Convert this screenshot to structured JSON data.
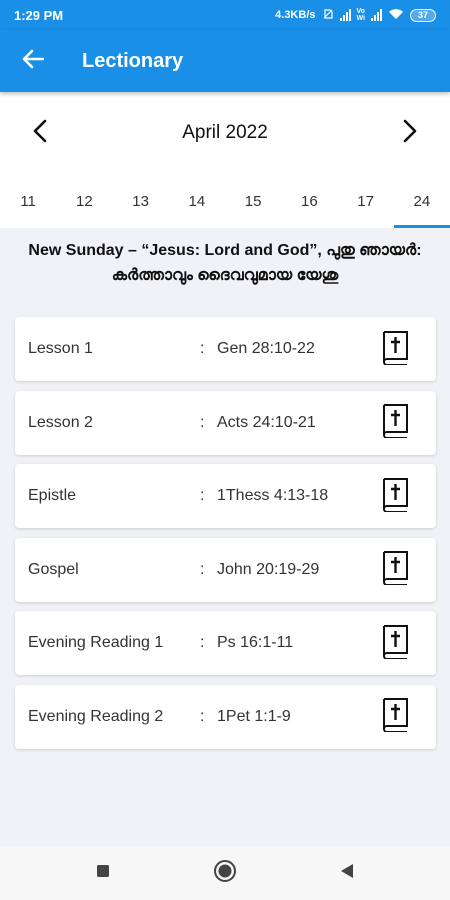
{
  "status_bar": {
    "time": "1:29 PM",
    "net_speed": "4.3KB/s",
    "vo_label": "Vo\nWiFi",
    "battery": "37"
  },
  "app_bar": {
    "title": "Lectionary",
    "back_icon": "arrow-left-icon"
  },
  "calendar": {
    "month": "April 2022",
    "prev_icon": "chevron-left-icon",
    "next_icon": "chevron-right-icon",
    "days": [
      "11",
      "12",
      "13",
      "14",
      "15",
      "16",
      "17",
      "24"
    ],
    "selected_day": "24"
  },
  "occasion": {
    "english": "New Sunday –  “Jesus: Lord and God”,",
    "malayalam": "പുതു ഞായർ: കർത്താവും ദൈവവുമായ യേശു"
  },
  "readings": [
    {
      "label": "Lesson 1",
      "ref": "Gen 28:10-22"
    },
    {
      "label": "Lesson 2",
      "ref": "Acts 24:10-21"
    },
    {
      "label": "Epistle",
      "ref": "1Thess 4:13-18"
    },
    {
      "label": "Gospel",
      "ref": "John 20:19-29"
    },
    {
      "label": "Evening Reading 1",
      "ref": "Ps 16:1-11"
    },
    {
      "label": "Evening Reading 2",
      "ref": "1Pet 1:1-9"
    }
  ],
  "colon": ":",
  "colors": {
    "primary": "#1a8fe8",
    "background": "#f1f2f7"
  },
  "nav": {
    "recent_icon": "square-icon",
    "home_icon": "circle-icon",
    "back_icon": "triangle-back-icon"
  }
}
